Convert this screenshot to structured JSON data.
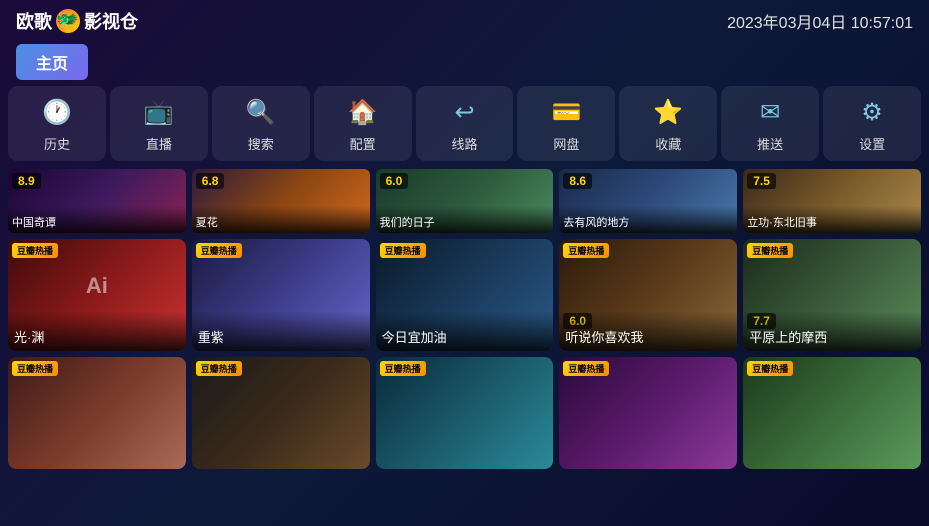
{
  "header": {
    "logo_text1": "欧歌",
    "logo_text2": "影视仓",
    "datetime": "2023年03月04日 10:57:01"
  },
  "home_btn": "主页",
  "nav": [
    {
      "label": "历史",
      "icon": "🕐"
    },
    {
      "label": "直播",
      "icon": "📺"
    },
    {
      "label": "搜索",
      "icon": "🔍"
    },
    {
      "label": "配置",
      "icon": "🏠"
    },
    {
      "label": "线路",
      "icon": "↩"
    },
    {
      "label": "网盘",
      "icon": "💳"
    },
    {
      "label": "收藏",
      "icon": "⭐"
    },
    {
      "label": "推送",
      "icon": "✉"
    },
    {
      "label": "设置",
      "icon": "⚙"
    }
  ],
  "rows": [
    {
      "type": "partial",
      "cards": [
        {
          "rating": "8.9",
          "title": "中国奇谭",
          "color": "c1"
        },
        {
          "rating": "6.8",
          "title": "夏花",
          "color": "c2"
        },
        {
          "rating": "6.0",
          "title": "我们的日子",
          "color": "c3"
        },
        {
          "rating": "8.6",
          "title": "去有风的地方",
          "color": "c4"
        },
        {
          "rating": "7.5",
          "title": "立功·东北旧事",
          "color": "c5"
        }
      ]
    },
    {
      "type": "main",
      "cards": [
        {
          "badge": "豆瓣热播",
          "title": "光·渊",
          "color": "c6",
          "deco": "Ai"
        },
        {
          "badge": "豆瓣热播",
          "title": "重紫",
          "color": "c7"
        },
        {
          "badge": "豆瓣热播",
          "title": "今日宜加油",
          "color": "c8"
        },
        {
          "badge": "豆瓣热播",
          "rating": "6.0",
          "title": "听说你喜欢我",
          "color": "c9"
        },
        {
          "badge": "豆瓣热播",
          "rating": "7.7",
          "title": "平原上的摩西",
          "color": "c10"
        }
      ]
    },
    {
      "type": "main",
      "cards": [
        {
          "badge": "豆瓣热播",
          "title": "",
          "color": "c11"
        },
        {
          "badge": "豆瓣热播",
          "title": "",
          "color": "c12"
        },
        {
          "badge": "豆瓣热播",
          "title": "",
          "color": "c13"
        },
        {
          "badge": "豆瓣热播",
          "title": "",
          "color": "c14"
        },
        {
          "badge": "豆瓣热播",
          "title": "",
          "color": "c15"
        }
      ]
    }
  ]
}
